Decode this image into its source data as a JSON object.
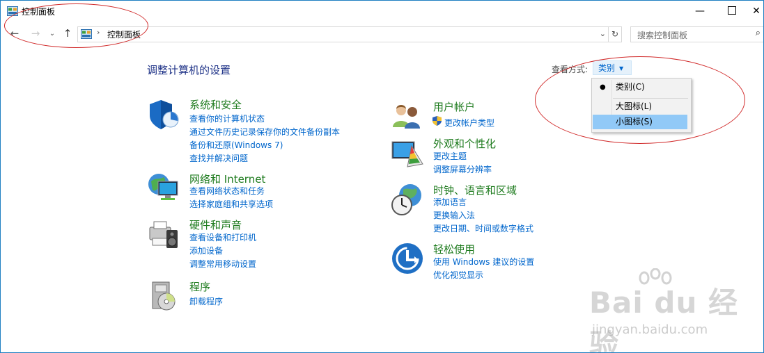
{
  "window": {
    "title": "控制面板",
    "controls": {
      "minimize": "—",
      "maximize": "",
      "close": "✕"
    }
  },
  "nav": {
    "back_icon": "←",
    "forward_icon": "→",
    "recent_icon": "⌄",
    "up_icon": "↑",
    "address_separator": "›",
    "address_path": "控制面板",
    "address_dropdown": "⌄",
    "refresh_icon": "↻",
    "search_placeholder": "搜索控制面板",
    "search_icon": "⌕"
  },
  "main": {
    "heading": "调整计算机的设置",
    "view_by": {
      "label": "查看方式:",
      "value": "类别"
    },
    "categories_left": [
      {
        "title": "系统和安全",
        "links": [
          "查看你的计算机状态",
          "通过文件历史记录保存你的文件备份副本",
          "备份和还原(Windows 7)",
          "查找并解决问题"
        ]
      },
      {
        "title": "网络和 Internet",
        "links": [
          "查看网络状态和任务",
          "选择家庭组和共享选项"
        ]
      },
      {
        "title": "硬件和声音",
        "links": [
          "查看设备和打印机",
          "添加设备",
          "调整常用移动设置"
        ]
      },
      {
        "title": "程序",
        "links": [
          "卸载程序"
        ]
      }
    ],
    "categories_right": [
      {
        "title": "用户帐户",
        "links": [
          "更改帐户类型"
        ]
      },
      {
        "title": "外观和个性化",
        "links": [
          "更改主题",
          "调整屏幕分辨率"
        ]
      },
      {
        "title": "时钟、语言和区域",
        "links": [
          "添加语言",
          "更换输入法",
          "更改日期、时间或数字格式"
        ]
      },
      {
        "title": "轻松使用",
        "links": [
          "使用 Windows 建议的设置",
          "优化视觉显示"
        ]
      }
    ]
  },
  "view_menu": {
    "items": [
      "类别(C)",
      "大图标(L)",
      "小图标(S)"
    ],
    "checked_bullet": "●",
    "selected_index": 0,
    "hovered_index": 2
  },
  "watermark": {
    "logo_text": "Bai du 经验",
    "url": "jingyan.baidu.com"
  },
  "colors": {
    "category_title": "#1e7b1e",
    "link": "#0066cc",
    "heading": "#1e3287",
    "annotation": "#d12b2b",
    "menu_hover": "#91c9f7"
  }
}
